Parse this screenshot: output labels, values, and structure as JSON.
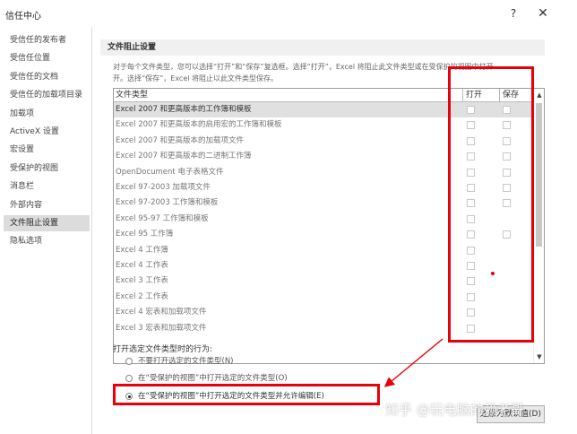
{
  "window": {
    "title": "信任中心",
    "help_label": "?",
    "close_label": "✕"
  },
  "sidebar": {
    "items": [
      {
        "label": "受信任的发布者"
      },
      {
        "label": "受信任位置"
      },
      {
        "label": "受信任的文档"
      },
      {
        "label": "受信任的加载项目录"
      },
      {
        "label": "加载项"
      },
      {
        "label": "ActiveX 设置"
      },
      {
        "label": "宏设置"
      },
      {
        "label": "受保护的视图"
      },
      {
        "label": "消息栏"
      },
      {
        "label": "外部内容"
      },
      {
        "label": "文件阻止设置"
      },
      {
        "label": "隐私选项"
      }
    ],
    "selected_index": 10
  },
  "section": {
    "title": "文件阻止设置",
    "description_line1": "对于每个文件类型，您可以选择“打开”和“保存”复选框。选择“打开”，Excel 将阻止此文件类型或在受保护的视图中打开",
    "description_line2": "开。选择“保存”，Excel 将阻止以此文件类型保存。"
  },
  "grid": {
    "col_type": "文件类型",
    "col_open": "打开",
    "col_save": "保存",
    "scroll_up": "▲",
    "scroll_down": "▼",
    "rows": [
      {
        "label": "Excel 2007 和更高版本的工作簿和模板",
        "open": false,
        "save": false,
        "has_save": true
      },
      {
        "label": "Excel 2007 和更高版本的启用宏的工作簿和模板",
        "open": false,
        "save": false,
        "has_save": true
      },
      {
        "label": "Excel 2007 和更高版本的加载项文件",
        "open": false,
        "save": false,
        "has_save": true
      },
      {
        "label": "Excel 2007 和更高版本的二进制工作簿",
        "open": false,
        "save": false,
        "has_save": true
      },
      {
        "label": "OpenDocument 电子表格文件",
        "open": false,
        "save": false,
        "has_save": true
      },
      {
        "label": "Excel 97-2003 加载项文件",
        "open": false,
        "save": false,
        "has_save": true
      },
      {
        "label": "Excel 97-2003 工作簿和模板",
        "open": false,
        "save": false,
        "has_save": true
      },
      {
        "label": "Excel 95-97 工作簿和模板",
        "open": false,
        "save": false,
        "has_save": false
      },
      {
        "label": "Excel 95 工作簿",
        "open": false,
        "save": false,
        "has_save": true
      },
      {
        "label": "Excel 4 工作簿",
        "open": false,
        "save": false,
        "has_save": false
      },
      {
        "label": "Excel 4 工作表",
        "open": false,
        "save": false,
        "has_save": false
      },
      {
        "label": "Excel 3 工作表",
        "open": false,
        "save": false,
        "has_save": false
      },
      {
        "label": "Excel 2 工作表",
        "open": false,
        "save": false,
        "has_save": false
      },
      {
        "label": "Excel 4 宏表和加载项文件",
        "open": false,
        "save": false,
        "has_save": false
      },
      {
        "label": "Excel 3 宏表和加载项文件",
        "open": false,
        "save": false,
        "has_save": false
      }
    ],
    "selected_index": 0
  },
  "behavior": {
    "label": "打开选定文件类型时的行为:",
    "options": [
      {
        "label": "不要打开选定的文件类型(N)",
        "checked": false
      },
      {
        "label": "在“受保护的视图”中打开选定的文件类型(O)",
        "checked": false
      },
      {
        "label": "在“受保护的视图”中打开选定的文件类型并允许编辑(E)",
        "checked": true
      }
    ]
  },
  "restore_button": {
    "label": "还原为默认值(D)"
  },
  "watermark": {
    "text": "知乎 @玩电脑的赖老哥"
  },
  "annotation_color": "#e8000b",
  "icons": {
    "help": "help-icon",
    "close": "close-icon",
    "radio": "radio-icon",
    "checkbox": "checkbox-icon"
  }
}
